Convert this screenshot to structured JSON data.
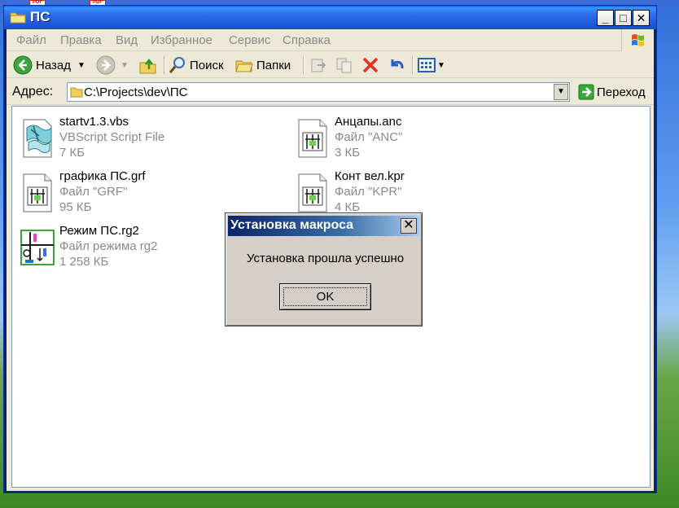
{
  "desktop": {
    "pdf_badges": [
      "PDF",
      "PDF"
    ]
  },
  "window": {
    "title": "ПС",
    "controls": {
      "minimize": "_",
      "maximize": "□",
      "close": "✕"
    }
  },
  "menu": [
    "Файл",
    "Правка",
    "Вид",
    "Избранное",
    "Сервис",
    "Справка"
  ],
  "toolbar": {
    "back_label": "Назад",
    "search_label": "Поиск",
    "folders_label": "Папки"
  },
  "address": {
    "label": "Адрес:",
    "value": "C:\\Projects\\dev\\ПС",
    "go_label": "Переход"
  },
  "files": [
    {
      "name": "startv1.3.vbs",
      "type": "VBScript Script File",
      "size": "7 КБ",
      "icon": "vbs-script-icon"
    },
    {
      "name": "Анцапы.anc",
      "type": "Файл \"ANC\"",
      "size": "3 КБ",
      "icon": "anc-file-icon"
    },
    {
      "name": "графика ПС.grf",
      "type": "Файл \"GRF\"",
      "size": "95 КБ",
      "icon": "grf-file-icon"
    },
    {
      "name": "Конт вел.kpr",
      "type": "Файл \"KPR\"",
      "size": "4 КБ",
      "icon": "kpr-file-icon"
    },
    {
      "name": "Режим ПС.rg2",
      "type": "Файл режима rg2",
      "size": "1 258 КБ",
      "icon": "rg2-file-icon"
    }
  ],
  "dialog": {
    "title": "Установка макроса",
    "close": "✕",
    "message": "Установка прошла успешно",
    "ok_label": "OK"
  }
}
